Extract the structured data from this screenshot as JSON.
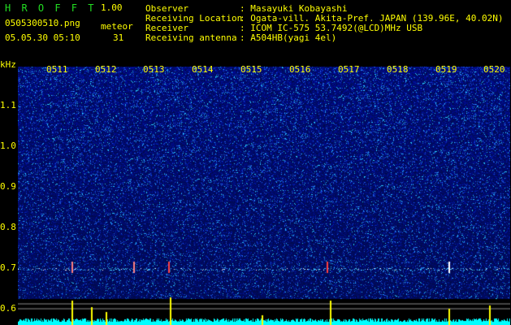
{
  "header": {
    "app_title": "H R O F F T",
    "version": "1.00",
    "filename": "0505300510.png",
    "meteor_label": "meteor",
    "meteor_count": "31",
    "datetime": "05.05.30 05:10"
  },
  "info": {
    "rows": [
      {
        "label": "Observer",
        "value": ": Masayuki Kobayashi"
      },
      {
        "label": "Receiving Location",
        "value": ": Ogata-vill. Akita-Pref. JAPAN (139.96E, 40.02N)"
      },
      {
        "label": "Receiver",
        "value": ": ICOM IC-575 53.7492(@LCD)MHz USB"
      },
      {
        "label": "Receiving antenna",
        "value": ": A504HB(yagi 4el)"
      }
    ]
  },
  "axis": {
    "unit": "kHz",
    "y_ticks": [
      "1.1",
      "1.0",
      "0.9",
      "0.8",
      "0.7",
      "0.6"
    ],
    "time_ticks": [
      "0511",
      "0512",
      "0513",
      "0514",
      "0515",
      "0516",
      "0517",
      "0518",
      "0519",
      "0520"
    ]
  },
  "colors": {
    "label_yellow": "#ffff00",
    "title_green": "#22dd22",
    "background_blue": "#0a1a7a",
    "signal_cyan": "#00ffff",
    "meteor_red": "#ff3030"
  }
}
